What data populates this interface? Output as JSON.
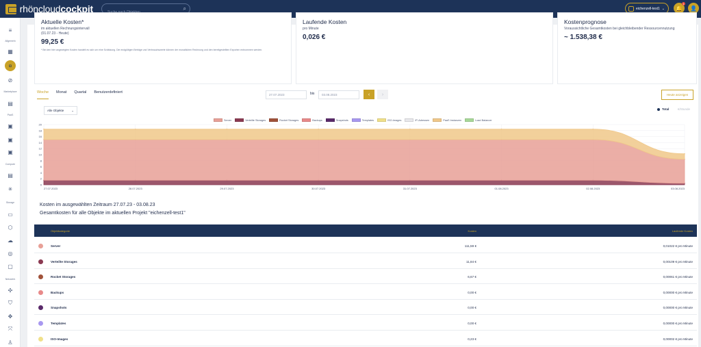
{
  "topbar": {
    "logo_light": "rhöncloud",
    "logo_bold": "cockpit",
    "search_placeholder": "Suche nach Objekten",
    "project": "eichenzell-test1",
    "notification_count": "1"
  },
  "sidebar": {
    "sections": [
      "Allgemein",
      "Marketplace",
      "PaaS",
      "Compute",
      "Storage",
      "Netzwerk"
    ]
  },
  "cards": {
    "current": {
      "title": "Aktuelle Kosten*",
      "sub1": "im aktuellen Rechnungsintervall",
      "sub2": "(01.07.23 - Heute)",
      "value": "99,25 €",
      "note": "* Bei den hier angezeigten Kosten handelt es sich um eine Schätzung. Die endgültigen Beträge und Verbrauchswerte können der monatlichen Rechnung und den bereitgestellten Exporten entnommen werden."
    },
    "running": {
      "title": "Laufende Kosten",
      "sub": "pro Minute",
      "value": "0,026 €"
    },
    "forecast": {
      "title": "Kostenprognose",
      "sub": "Voraussichtliche Gesamtkosten bei gleichbleibender Ressourcennutzung",
      "value": "~ 1.538,38 €"
    }
  },
  "tabs": [
    "Woche",
    "Monat",
    "Quartal",
    "Benutzerdefiniert"
  ],
  "date_from": "27.07.2023",
  "date_to": "03.08.2023",
  "bis_label": "bis",
  "today_button": "Heute anzeigen",
  "object_select": "Alle Objekte",
  "toggle_total": "Total",
  "toggle_hour": "€/Stunde",
  "legend": [
    {
      "name": "Server",
      "color": "#e8a097"
    },
    {
      "name": "Verteilte Storages",
      "color": "#8b3a52"
    },
    {
      "name": "Rocket Storages",
      "color": "#a0523a"
    },
    {
      "name": "Backups",
      "color": "#e88a8a"
    },
    {
      "name": "Snapshots",
      "color": "#5a2a6a"
    },
    {
      "name": "Templates",
      "color": "#a898f0"
    },
    {
      "name": "ISO-Images",
      "color": "#f0e08a"
    },
    {
      "name": "IP-Adressen",
      "color": "#e8e8ec"
    },
    {
      "name": "PaaS Instanzen",
      "color": "#f0c88a"
    },
    {
      "name": "Load Balancer",
      "color": "#a8d898"
    }
  ],
  "chart_data": {
    "type": "area",
    "x": [
      "27.07.2023",
      "28.07.2023",
      "29.07.2023",
      "30.07.2023",
      "31.07.2023",
      "01.08.2023",
      "02.08.2023",
      "03.08.2023"
    ],
    "ylim": [
      0,
      20
    ],
    "yticks": [
      0,
      2,
      4,
      6,
      8,
      10,
      12,
      14,
      16,
      18,
      20
    ],
    "series": [
      {
        "name": "Verteilte Storages",
        "values": [
          1.5,
          1.5,
          1.5,
          1.5,
          1.5,
          1.5,
          1.5,
          0.5
        ]
      },
      {
        "name": "Server",
        "values": [
          13.5,
          13.5,
          13.5,
          13.5,
          13.5,
          13.5,
          13.5,
          8.0
        ]
      },
      {
        "name": "PaaS Instanzen",
        "values": [
          3.5,
          3.5,
          3.5,
          3.5,
          3.5,
          3.5,
          3.5,
          1.8
        ]
      }
    ]
  },
  "summary": {
    "line1": "Kosten im ausgewählten Zeitraum 27.07.23 - 03.08.23",
    "line2": "Gesamtkosten für alle Objekte im aktuellen Projekt \"eichenzell-test1\""
  },
  "table": {
    "headers": [
      "Objektkategorie",
      "Kosten",
      "Laufende Kosten"
    ],
    "rows": [
      {
        "name": "Server",
        "cost": "111,59 €",
        "running": "0,01022 € pro Minute",
        "color": "#e8a097"
      },
      {
        "name": "Verteilte Storages",
        "cost": "11,84 €",
        "running": "0,00109 € pro Minute",
        "color": "#8b3a52"
      },
      {
        "name": "Rocket Storages",
        "cost": "6,67 €",
        "running": "0,00061 € pro Minute",
        "color": "#a0523a"
      },
      {
        "name": "Backups",
        "cost": "0,00 €",
        "running": "0,00000 € pro Minute",
        "color": "#e88a8a"
      },
      {
        "name": "Snapshots",
        "cost": "0,00 €",
        "running": "0,00000 € pro Minute",
        "color": "#5a2a6a"
      },
      {
        "name": "Templates",
        "cost": "0,00 €",
        "running": "0,00000 € pro Minute",
        "color": "#a898f0"
      },
      {
        "name": "ISO-Images",
        "cost": "0,23 €",
        "running": "0,00002 € pro Minute",
        "color": "#f0e08a"
      }
    ]
  }
}
